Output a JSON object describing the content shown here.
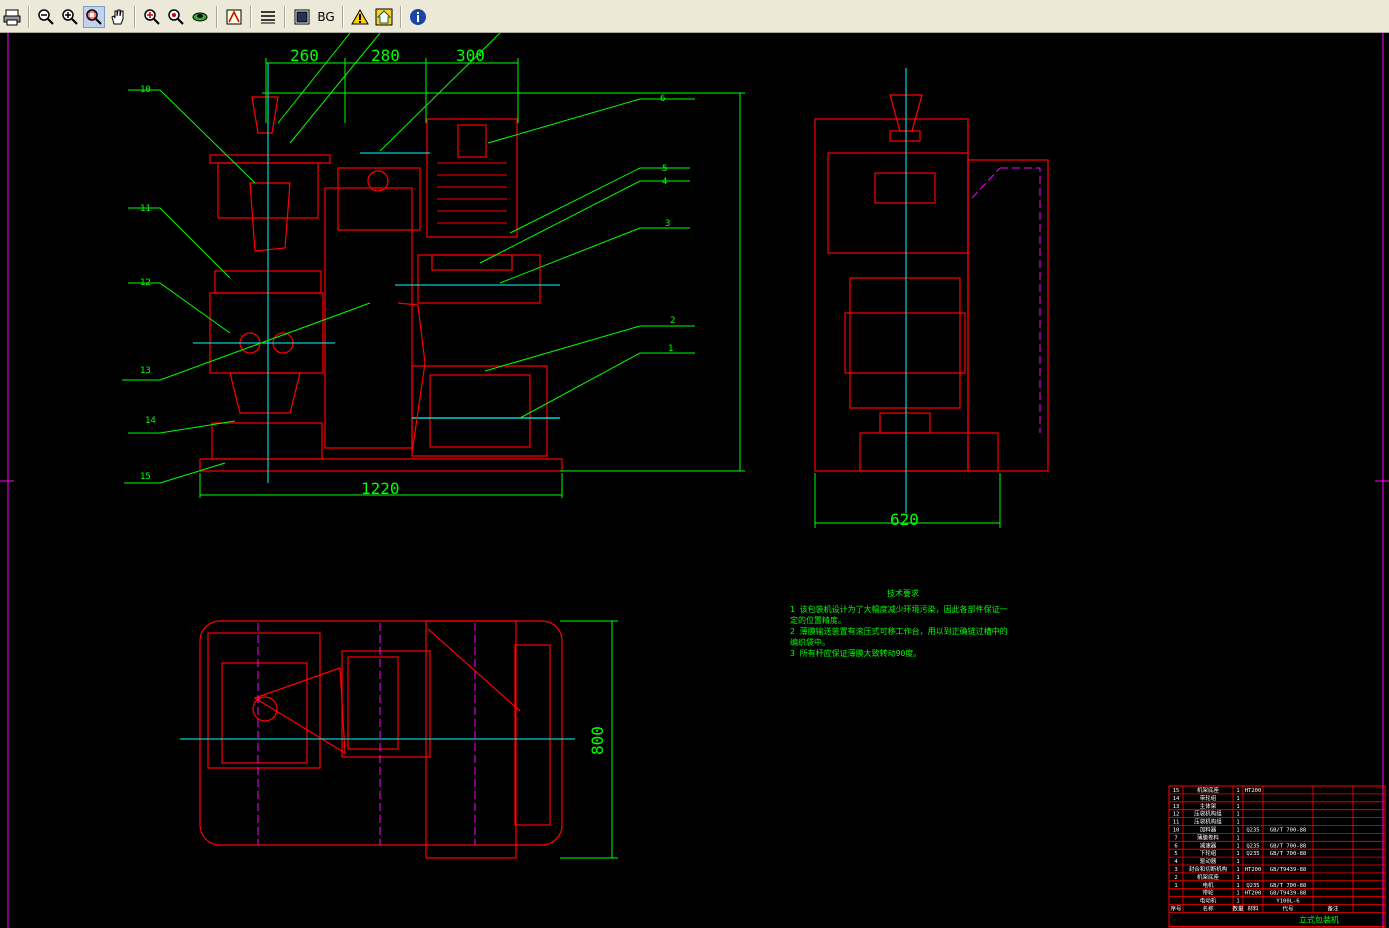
{
  "toolbar": {
    "buttons": [
      {
        "name": "print-button",
        "icon": "printer-icon"
      },
      {
        "name": "zoom-out-button",
        "icon": "zoom-out-icon"
      },
      {
        "name": "zoom-in-button",
        "icon": "zoom-in-icon"
      },
      {
        "name": "zoom-window-button",
        "icon": "zoom-window-icon",
        "active": true
      },
      {
        "name": "pan-button",
        "icon": "hand-icon"
      },
      {
        "name": "zoom-all-button",
        "icon": "zoom-all-icon"
      },
      {
        "name": "zoom-extents-button",
        "icon": "zoom-extents-icon"
      },
      {
        "name": "layers-button",
        "icon": "layers-icon"
      },
      {
        "name": "linetype-button",
        "icon": "linetype-icon"
      },
      {
        "name": "properties-button",
        "icon": "properties-icon"
      },
      {
        "name": "screen-button",
        "icon": "screen-icon"
      },
      {
        "name": "bg-button",
        "label": "BG"
      },
      {
        "name": "warning-button",
        "icon": "warning-icon"
      },
      {
        "name": "home-button",
        "icon": "home-icon"
      },
      {
        "name": "info-button",
        "icon": "info-icon"
      }
    ]
  },
  "colors": {
    "background": "#000000",
    "outline": "#ff0000",
    "dimension": "#00ff00",
    "centerline": "#00ffff",
    "hidden": "#ff00ff",
    "white": "#ffffff",
    "yellow": "#ffff00",
    "toolbar": "#ece9d8"
  },
  "drawing": {
    "front_dims": {
      "d1": "260",
      "d2": "280",
      "d3": "300",
      "overall_width": "1220"
    },
    "side_dims": {
      "width": "620"
    },
    "plan_dims": {
      "depth": "800"
    },
    "callouts_left": [
      "10",
      "11",
      "12",
      "13",
      "14",
      "15"
    ],
    "callouts_right": [
      "6",
      "5",
      "4",
      "3",
      "2",
      "1"
    ],
    "tech": {
      "title": "技术要求",
      "lines": [
        "1 该包装机设计为了大幅度减少环境污染，因此各部件保证一",
        "定的位置精度。",
        "2 薄膜输送装置有滚压式可移工作台，用以到正确链过槽中的",
        "编织袋中。",
        "3 所有杆应保证薄膜大致转动90度。"
      ]
    },
    "bom": {
      "rows": [
        {
          "no": "15",
          "name": "机架底座",
          "qty": "1",
          "mat": "HT200",
          "std": "",
          "note": ""
        },
        {
          "no": "14",
          "name": "带轮组",
          "qty": "1",
          "mat": "",
          "std": "",
          "note": ""
        },
        {
          "no": "13",
          "name": "主体架",
          "qty": "1",
          "mat": "",
          "std": "",
          "note": ""
        },
        {
          "no": "12",
          "name": "压袋机构组",
          "qty": "1",
          "mat": "",
          "std": "",
          "note": ""
        },
        {
          "no": "11",
          "name": "压袋机构组",
          "qty": "1",
          "mat": "",
          "std": "",
          "note": ""
        },
        {
          "no": "10",
          "name": "加料器",
          "qty": "1",
          "mat": "Q235",
          "std": "GB/T 700-88",
          "note": ""
        },
        {
          "no": "7",
          "name": "薄膜卷料",
          "qty": "1",
          "mat": "",
          "std": "",
          "note": ""
        },
        {
          "no": "6",
          "name": "减速器",
          "qty": "1",
          "mat": "Q235",
          "std": "GB/T 700-88",
          "note": ""
        },
        {
          "no": "5",
          "name": "下轮组",
          "qty": "1",
          "mat": "Q235",
          "std": "GB/T 700-88",
          "note": ""
        },
        {
          "no": "4",
          "name": "驱动器",
          "qty": "1",
          "mat": "",
          "std": "",
          "note": ""
        },
        {
          "no": "3",
          "name": "封合和切断机构",
          "qty": "1",
          "mat": "HT200",
          "std": "GB/T9439-88",
          "note": ""
        },
        {
          "no": "2",
          "name": "机架底座",
          "qty": "1",
          "mat": "",
          "std": "",
          "note": ""
        },
        {
          "no": "1",
          "name": "电机",
          "qty": "1",
          "mat": "Q235",
          "std": "GB/T 700-88",
          "note": ""
        },
        {
          "no": "",
          "name": "带轮",
          "qty": "1",
          "mat": "HT200",
          "std": "GB/T9439-88",
          "note": ""
        },
        {
          "no": "",
          "name": "电动机",
          "qty": "1",
          "mat": "",
          "std": "Y100L-6",
          "note": ""
        }
      ],
      "header": {
        "no": "序号",
        "name": "名称",
        "qty": "数量",
        "mat": "材料",
        "std": "代号",
        "note": "备注"
      },
      "title_partial": "立式包装机"
    }
  }
}
